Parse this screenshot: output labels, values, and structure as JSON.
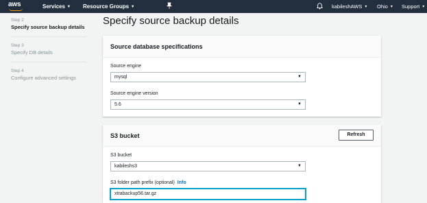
{
  "nav": {
    "logo_text": "aws",
    "services": "Services",
    "resource_groups": "Resource Groups",
    "user": "kabileshAWS",
    "region": "Ohio",
    "support": "Support",
    "caret": "▾",
    "pin_icon": "pin-icon",
    "bell_icon": "bell-icon"
  },
  "steps": [
    {
      "num": "Step 2",
      "title": "Specify source backup details",
      "active": true
    },
    {
      "num": "Step 3",
      "title": "Specify DB details",
      "active": false
    },
    {
      "num": "Step 4",
      "title": "Configure advanced settings",
      "active": false
    }
  ],
  "page_title": "Specify source backup details",
  "source_panel": {
    "title": "Source database specifications",
    "engine_label": "Source engine",
    "engine_value": "mysql",
    "version_label": "Source engine version",
    "version_value": "5.6"
  },
  "s3_panel": {
    "title": "S3 bucket",
    "refresh_label": "Refresh",
    "bucket_label": "S3 bucket",
    "bucket_value": "kabileshs3",
    "prefix_label": "S3 folder path prefix (optional)",
    "info_label": "Info",
    "prefix_value": "xtrabackup56.tar.gz"
  },
  "colors": {
    "nav_bg": "#232f3e",
    "accent": "#ff9900",
    "link": "#0073bb",
    "focus": "#00a1c9"
  }
}
